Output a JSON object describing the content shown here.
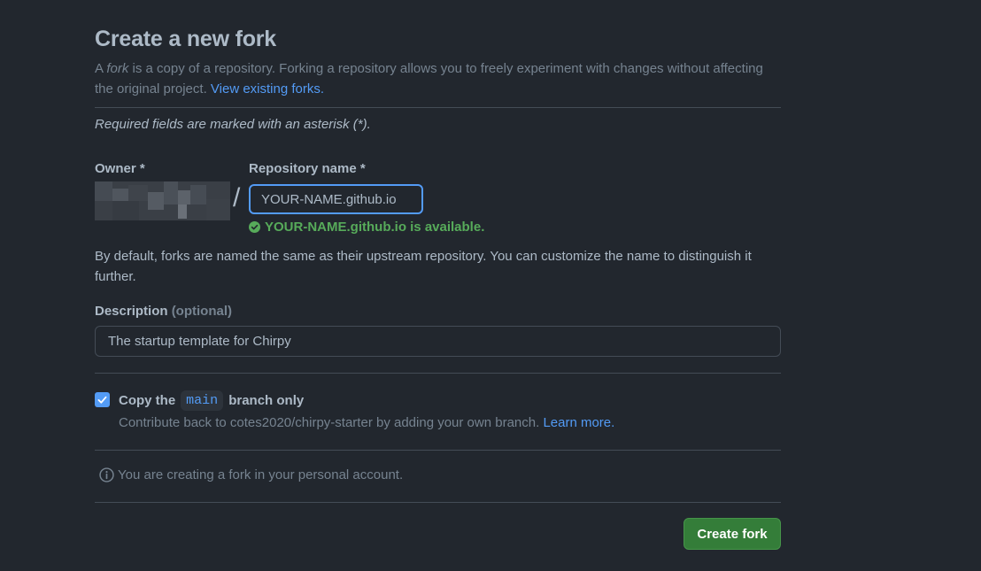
{
  "page": {
    "title": "Create a new fork",
    "intro": {
      "prefix": "A ",
      "fork_word": "fork",
      "text": " is a copy of a repository. Forking a repository allows you to freely experiment with changes without affecting the original project. ",
      "link": "View existing forks."
    },
    "required_note": "Required fields are marked with an asterisk (*)."
  },
  "owner": {
    "label": "Owner *"
  },
  "separator": "/",
  "repository": {
    "label": "Repository name *",
    "value": "YOUR-NAME.github.io",
    "availability": "YOUR-NAME.github.io is available."
  },
  "hint": "By default, forks are named the same as their upstream repository. You can customize the name to distinguish it further.",
  "description": {
    "label": "Description",
    "optional": "(optional)",
    "value": "The startup template for Chirpy"
  },
  "copy_branch": {
    "checked": true,
    "label_before": "Copy the",
    "branch": "main",
    "label_after": "branch only",
    "contrib_text": "Contribute back to cotes2020/chirpy-starter by adding your own branch. ",
    "learn_more": "Learn more."
  },
  "info": {
    "icon": "info-icon",
    "text": "You are creating a fork in your personal account."
  },
  "actions": {
    "create_label": "Create fork"
  },
  "colors": {
    "background": "#22272e",
    "accent": "#539bf5",
    "success": "#57ab5a",
    "button": "#347d39"
  }
}
